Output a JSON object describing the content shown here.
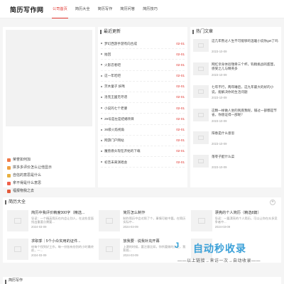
{
  "header": {
    "logo": "简历写作网",
    "nav": [
      "公司首页",
      "简历大全",
      "简历写作",
      "简历问答",
      "简历技巧"
    ]
  },
  "categories": {
    "items": [
      {
        "label": "荣誉如何加",
        "color": "#f07a4a"
      },
      {
        "label": "拼多多评价怎么让他显示",
        "color": "#f0a040"
      },
      {
        "label": "自信的意思是什么",
        "color": "#e7b040"
      },
      {
        "label": "拿不得是什么意思",
        "color": "#f0604a"
      },
      {
        "label": "福报物我之去",
        "color": "#e35a3a"
      }
    ]
  },
  "latest": {
    "title": "最近更新",
    "items": [
      {
        "title": "梦幻西游手游有向合成",
        "date": "02-01"
      },
      {
        "title": "拍回",
        "date": "02-01"
      },
      {
        "title": "火影忍者吧",
        "date": "02-01"
      },
      {
        "title": "这一年吃吧",
        "date": "02-01"
      },
      {
        "title": "茨木童子 妖嗎",
        "date": "02-01"
      },
      {
        "title": "洛克王國无尽谱",
        "date": "02-01"
      },
      {
        "title": "小说的七个老婆",
        "date": "02-01"
      },
      {
        "title": "29号是左是结婚项目",
        "date": "02-01"
      },
      {
        "title": "36级火焰视角",
        "date": "02-01"
      },
      {
        "title": "网游门户网站",
        "date": "02-01"
      },
      {
        "title": "魔兽悬头现在开始的下载",
        "date": "02-01"
      },
      {
        "title": "初音未来演唱会",
        "date": "02-01"
      }
    ]
  },
  "hot": {
    "title": "热门文章",
    "items": [
      {
        "title": "这几年熬过人生不可能够的温暖小说你get了吗",
        "date": "2023-10-09"
      },
      {
        "title": "网红亲身体验瑞幸三个杯，钩稿挑战的甜蜜，感受之儿与精英多",
        "date": "2023-10-09"
      },
      {
        "title": "七年不行，两年睡后，这九年最大的好的小说，能解决你的生活问题",
        "date": "2023-10-09"
      },
      {
        "title": "这颗一样做人坐的到底我呢，铺过一部都是节省，你值证得一部呢？",
        "date": "2023-10-09"
      },
      {
        "title": "阳春是什么意思",
        "date": "2023-10-09"
      },
      {
        "title": "落枣子配什么菜",
        "date": "2023-10-09"
      }
    ]
  },
  "resume": {
    "title": "简历大全",
    "more": "+",
    "cards": [
      {
        "title": "简历中我评价精度300字（精选...",
        "desc": "导读：一个精英简历在内会让别人，在这些里面找出重要点需要...",
        "date": "2024-03-09"
      },
      {
        "title": "简历怎么制作",
        "desc": "制作简历中会对照了个，事情可能中要。在简历实际中...",
        "date": "2024-03-09"
      },
      {
        "title": "漂亮的个人简历（精选8篇）",
        "desc": "导读：一篇漂亮的个人简历，可以让你在众多竞争者中...",
        "date": "2024-03-09"
      },
      {
        "title": "求职季｜5个小众实用的证件...",
        "desc": "给每个找到好工作，每一份各有份别的小时最终前，一...",
        "date": "2024-03-09"
      },
      {
        "title": "放我要 · 说我补充开幕",
        "desc": "上课的时候，要注意比如，你所要做的大主，我和简...",
        "date": "2024-03-09"
      },
      {
        "title": "",
        "desc": "",
        "date": ""
      }
    ]
  },
  "footer_strip": {
    "title": "简历写作"
  },
  "watermark": {
    "logo": "J",
    "text": "自动秒收录",
    "sub": "——以上链接→来访一次→自动收录——"
  }
}
